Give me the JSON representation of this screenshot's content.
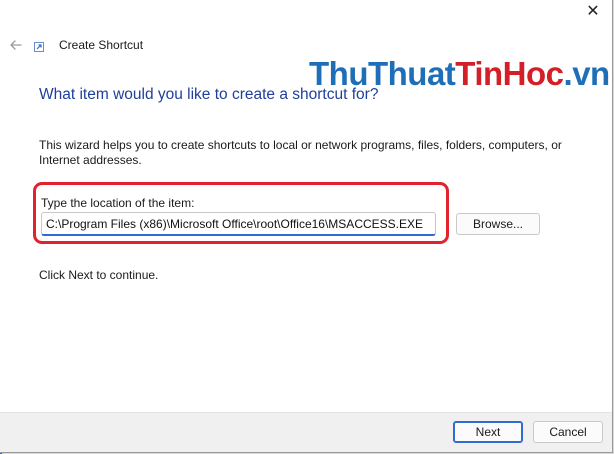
{
  "window": {
    "title": "Create Shortcut",
    "icons": {
      "back": "back-arrow-icon",
      "app": "shortcut-icon",
      "close": "close-icon"
    }
  },
  "watermark": {
    "part1": "ThuThuat",
    "part2": "TinHoc",
    "part3": ".vn"
  },
  "content": {
    "heading": "What item would you like to create a shortcut for?",
    "description": "This wizard helps you to create shortcuts to local or network programs, files, folders, computers, or Internet addresses.",
    "location_label": "Type the location of the item:",
    "location_value": "C:\\Program Files (x86)\\Microsoft Office\\root\\Office16\\MSACCESS.EXE",
    "browse_label": "Browse...",
    "continue_text": "Click Next to continue."
  },
  "footer": {
    "next_label": "Next",
    "cancel_label": "Cancel"
  },
  "colors": {
    "heading": "#1f3f9a",
    "accent": "#2f6bd0",
    "highlight": "#e2222f",
    "watermark_blue": "#1e6fb8",
    "watermark_red": "#d21f28"
  }
}
